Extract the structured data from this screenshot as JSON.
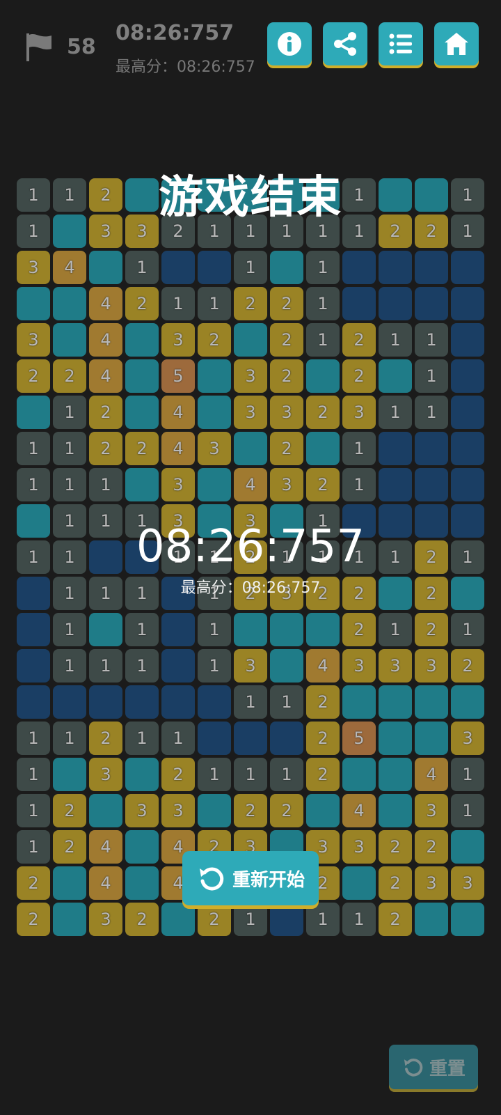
{
  "status": {
    "flag_count": "58",
    "timer": "08:26:757",
    "best_score": "最高分：08:26:757"
  },
  "toolbar": {
    "info_icon": "info-icon",
    "share_icon": "share-icon",
    "list_icon": "list-icon",
    "home_icon": "home-icon"
  },
  "overlay": {
    "title": "游戏结束",
    "time": "08:26:757",
    "best": "最高分：08:26:757",
    "restart_label": "重新开始"
  },
  "footer": {
    "reset_label": "重置"
  },
  "board": {
    "rows": 21,
    "cols": 13,
    "tile_colors": {
      "g": "#3e4a48",
      "t": "#1f7c88",
      "b": "#1a3e64",
      "y": "#9a8325",
      "o": "#a07a30",
      "r": "#9d6a3c"
    },
    "cells": [
      [
        [
          "g",
          "1"
        ],
        [
          "g",
          "1"
        ],
        [
          "y",
          "2"
        ],
        [
          "t",
          ""
        ],
        [
          "t",
          ""
        ],
        [
          "t",
          ""
        ],
        [
          "t",
          ""
        ],
        [
          "t",
          ""
        ],
        [
          "t",
          ""
        ],
        [
          "g",
          "1"
        ],
        [
          "t",
          ""
        ],
        [
          "t",
          ""
        ],
        [
          "g",
          "1"
        ]
      ],
      [
        [
          "g",
          "1"
        ],
        [
          "t",
          ""
        ],
        [
          "y",
          "3"
        ],
        [
          "y",
          "3"
        ],
        [
          "g",
          "2"
        ],
        [
          "g",
          "1"
        ],
        [
          "g",
          "1"
        ],
        [
          "g",
          "1"
        ],
        [
          "g",
          "1"
        ],
        [
          "g",
          "1"
        ],
        [
          "y",
          "2"
        ],
        [
          "y",
          "2"
        ],
        [
          "g",
          "1"
        ]
      ],
      [
        [
          "y",
          "3"
        ],
        [
          "o",
          "4"
        ],
        [
          "t",
          ""
        ],
        [
          "g",
          "1"
        ],
        [
          "b",
          ""
        ],
        [
          "b",
          ""
        ],
        [
          "g",
          "1"
        ],
        [
          "t",
          ""
        ],
        [
          "g",
          "1"
        ],
        [
          "b",
          ""
        ],
        [
          "b",
          ""
        ],
        [
          "b",
          ""
        ],
        [
          "b",
          ""
        ]
      ],
      [
        [
          "t",
          ""
        ],
        [
          "t",
          ""
        ],
        [
          "o",
          "4"
        ],
        [
          "y",
          "2"
        ],
        [
          "g",
          "1"
        ],
        [
          "g",
          "1"
        ],
        [
          "y",
          "2"
        ],
        [
          "y",
          "2"
        ],
        [
          "g",
          "1"
        ],
        [
          "b",
          ""
        ],
        [
          "b",
          ""
        ],
        [
          "b",
          ""
        ],
        [
          "b",
          ""
        ]
      ],
      [
        [
          "y",
          "3"
        ],
        [
          "t",
          ""
        ],
        [
          "o",
          "4"
        ],
        [
          "t",
          ""
        ],
        [
          "y",
          "3"
        ],
        [
          "y",
          "2"
        ],
        [
          "t",
          ""
        ],
        [
          "y",
          "2"
        ],
        [
          "g",
          "1"
        ],
        [
          "y",
          "2"
        ],
        [
          "g",
          "1"
        ],
        [
          "g",
          "1"
        ],
        [
          "b",
          ""
        ]
      ],
      [
        [
          "y",
          "2"
        ],
        [
          "y",
          "2"
        ],
        [
          "o",
          "4"
        ],
        [
          "t",
          ""
        ],
        [
          "r",
          "5"
        ],
        [
          "t",
          ""
        ],
        [
          "y",
          "3"
        ],
        [
          "y",
          "2"
        ],
        [
          "t",
          ""
        ],
        [
          "y",
          "2"
        ],
        [
          "t",
          ""
        ],
        [
          "g",
          "1"
        ],
        [
          "b",
          ""
        ]
      ],
      [
        [
          "t",
          ""
        ],
        [
          "g",
          "1"
        ],
        [
          "y",
          "2"
        ],
        [
          "t",
          ""
        ],
        [
          "o",
          "4"
        ],
        [
          "t",
          ""
        ],
        [
          "y",
          "3"
        ],
        [
          "y",
          "3"
        ],
        [
          "y",
          "2"
        ],
        [
          "y",
          "3"
        ],
        [
          "g",
          "1"
        ],
        [
          "g",
          "1"
        ],
        [
          "b",
          ""
        ]
      ],
      [
        [
          "g",
          "1"
        ],
        [
          "g",
          "1"
        ],
        [
          "y",
          "2"
        ],
        [
          "y",
          "2"
        ],
        [
          "o",
          "4"
        ],
        [
          "y",
          "3"
        ],
        [
          "t",
          ""
        ],
        [
          "y",
          "2"
        ],
        [
          "t",
          ""
        ],
        [
          "g",
          "1"
        ],
        [
          "b",
          ""
        ],
        [
          "b",
          ""
        ],
        [
          "b",
          ""
        ]
      ],
      [
        [
          "g",
          "1"
        ],
        [
          "g",
          "1"
        ],
        [
          "g",
          "1"
        ],
        [
          "t",
          ""
        ],
        [
          "y",
          "3"
        ],
        [
          "t",
          ""
        ],
        [
          "o",
          "4"
        ],
        [
          "y",
          "3"
        ],
        [
          "y",
          "2"
        ],
        [
          "g",
          "1"
        ],
        [
          "b",
          ""
        ],
        [
          "b",
          ""
        ],
        [
          "b",
          ""
        ]
      ],
      [
        [
          "t",
          ""
        ],
        [
          "g",
          "1"
        ],
        [
          "g",
          "1"
        ],
        [
          "g",
          "1"
        ],
        [
          "y",
          "3"
        ],
        [
          "t",
          ""
        ],
        [
          "y",
          "3"
        ],
        [
          "t",
          ""
        ],
        [
          "g",
          "1"
        ],
        [
          "b",
          ""
        ],
        [
          "b",
          ""
        ],
        [
          "b",
          ""
        ],
        [
          "b",
          ""
        ]
      ],
      [
        [
          "g",
          "1"
        ],
        [
          "g",
          "1"
        ],
        [
          "b",
          ""
        ],
        [
          "b",
          ""
        ],
        [
          "g",
          "1"
        ],
        [
          "g",
          "1"
        ],
        [
          "y",
          "2"
        ],
        [
          "g",
          "1"
        ],
        [
          "g",
          "1"
        ],
        [
          "g",
          "1"
        ],
        [
          "g",
          "1"
        ],
        [
          "y",
          "2"
        ],
        [
          "g",
          "1"
        ]
      ],
      [
        [
          "b",
          ""
        ],
        [
          "g",
          "1"
        ],
        [
          "g",
          "1"
        ],
        [
          "g",
          "1"
        ],
        [
          "b",
          ""
        ],
        [
          "g",
          "1"
        ],
        [
          "y",
          "2"
        ],
        [
          "y",
          "3"
        ],
        [
          "y",
          "2"
        ],
        [
          "y",
          "2"
        ],
        [
          "t",
          ""
        ],
        [
          "y",
          "2"
        ],
        [
          "t",
          ""
        ]
      ],
      [
        [
          "b",
          ""
        ],
        [
          "g",
          "1"
        ],
        [
          "t",
          ""
        ],
        [
          "g",
          "1"
        ],
        [
          "b",
          ""
        ],
        [
          "g",
          "1"
        ],
        [
          "t",
          ""
        ],
        [
          "t",
          ""
        ],
        [
          "t",
          ""
        ],
        [
          "y",
          "2"
        ],
        [
          "g",
          "1"
        ],
        [
          "y",
          "2"
        ],
        [
          "g",
          "1"
        ]
      ],
      [
        [
          "b",
          ""
        ],
        [
          "g",
          "1"
        ],
        [
          "g",
          "1"
        ],
        [
          "g",
          "1"
        ],
        [
          "b",
          ""
        ],
        [
          "g",
          "1"
        ],
        [
          "y",
          "3"
        ],
        [
          "t",
          ""
        ],
        [
          "o",
          "4"
        ],
        [
          "y",
          "3"
        ],
        [
          "y",
          "3"
        ],
        [
          "y",
          "3"
        ],
        [
          "y",
          "2"
        ]
      ],
      [
        [
          "b",
          ""
        ],
        [
          "b",
          ""
        ],
        [
          "b",
          ""
        ],
        [
          "b",
          ""
        ],
        [
          "b",
          ""
        ],
        [
          "b",
          ""
        ],
        [
          "g",
          "1"
        ],
        [
          "g",
          "1"
        ],
        [
          "y",
          "2"
        ],
        [
          "t",
          ""
        ],
        [
          "t",
          ""
        ],
        [
          "t",
          ""
        ],
        [
          "t",
          ""
        ]
      ],
      [
        [
          "g",
          "1"
        ],
        [
          "g",
          "1"
        ],
        [
          "y",
          "2"
        ],
        [
          "g",
          "1"
        ],
        [
          "g",
          "1"
        ],
        [
          "b",
          ""
        ],
        [
          "b",
          ""
        ],
        [
          "b",
          ""
        ],
        [
          "y",
          "2"
        ],
        [
          "r",
          "5"
        ],
        [
          "t",
          ""
        ],
        [
          "t",
          ""
        ],
        [
          "y",
          "3"
        ]
      ],
      [
        [
          "g",
          "1"
        ],
        [
          "t",
          ""
        ],
        [
          "y",
          "3"
        ],
        [
          "t",
          ""
        ],
        [
          "y",
          "2"
        ],
        [
          "g",
          "1"
        ],
        [
          "g",
          "1"
        ],
        [
          "g",
          "1"
        ],
        [
          "y",
          "2"
        ],
        [
          "t",
          ""
        ],
        [
          "t",
          ""
        ],
        [
          "o",
          "4"
        ],
        [
          "g",
          "1"
        ]
      ],
      [
        [
          "g",
          "1"
        ],
        [
          "y",
          "2"
        ],
        [
          "t",
          ""
        ],
        [
          "y",
          "3"
        ],
        [
          "y",
          "3"
        ],
        [
          "t",
          ""
        ],
        [
          "y",
          "2"
        ],
        [
          "y",
          "2"
        ],
        [
          "t",
          ""
        ],
        [
          "o",
          "4"
        ],
        [
          "t",
          ""
        ],
        [
          "y",
          "3"
        ],
        [
          "g",
          "1"
        ]
      ],
      [
        [
          "g",
          "1"
        ],
        [
          "y",
          "2"
        ],
        [
          "o",
          "4"
        ],
        [
          "t",
          ""
        ],
        [
          "o",
          "4"
        ],
        [
          "y",
          "2"
        ],
        [
          "y",
          "3"
        ],
        [
          "t",
          ""
        ],
        [
          "y",
          "3"
        ],
        [
          "y",
          "3"
        ],
        [
          "y",
          "2"
        ],
        [
          "y",
          "2"
        ],
        [
          "t",
          ""
        ]
      ],
      [
        [
          "y",
          "2"
        ],
        [
          "t",
          ""
        ],
        [
          "o",
          "4"
        ],
        [
          "t",
          ""
        ],
        [
          "o",
          "4"
        ],
        [
          "t",
          ""
        ],
        [
          "t",
          ""
        ],
        [
          "t",
          ""
        ],
        [
          "y",
          "2"
        ],
        [
          "t",
          ""
        ],
        [
          "y",
          "2"
        ],
        [
          "y",
          "3"
        ],
        [
          "y",
          "3"
        ]
      ],
      [
        [
          "y",
          "2"
        ],
        [
          "t",
          ""
        ],
        [
          "y",
          "3"
        ],
        [
          "y",
          "2"
        ],
        [
          "t",
          ""
        ],
        [
          "y",
          "2"
        ],
        [
          "g",
          "1"
        ],
        [
          "b",
          ""
        ],
        [
          "g",
          "1"
        ],
        [
          "g",
          "1"
        ],
        [
          "y",
          "2"
        ],
        [
          "t",
          ""
        ],
        [
          "t",
          ""
        ]
      ]
    ]
  }
}
